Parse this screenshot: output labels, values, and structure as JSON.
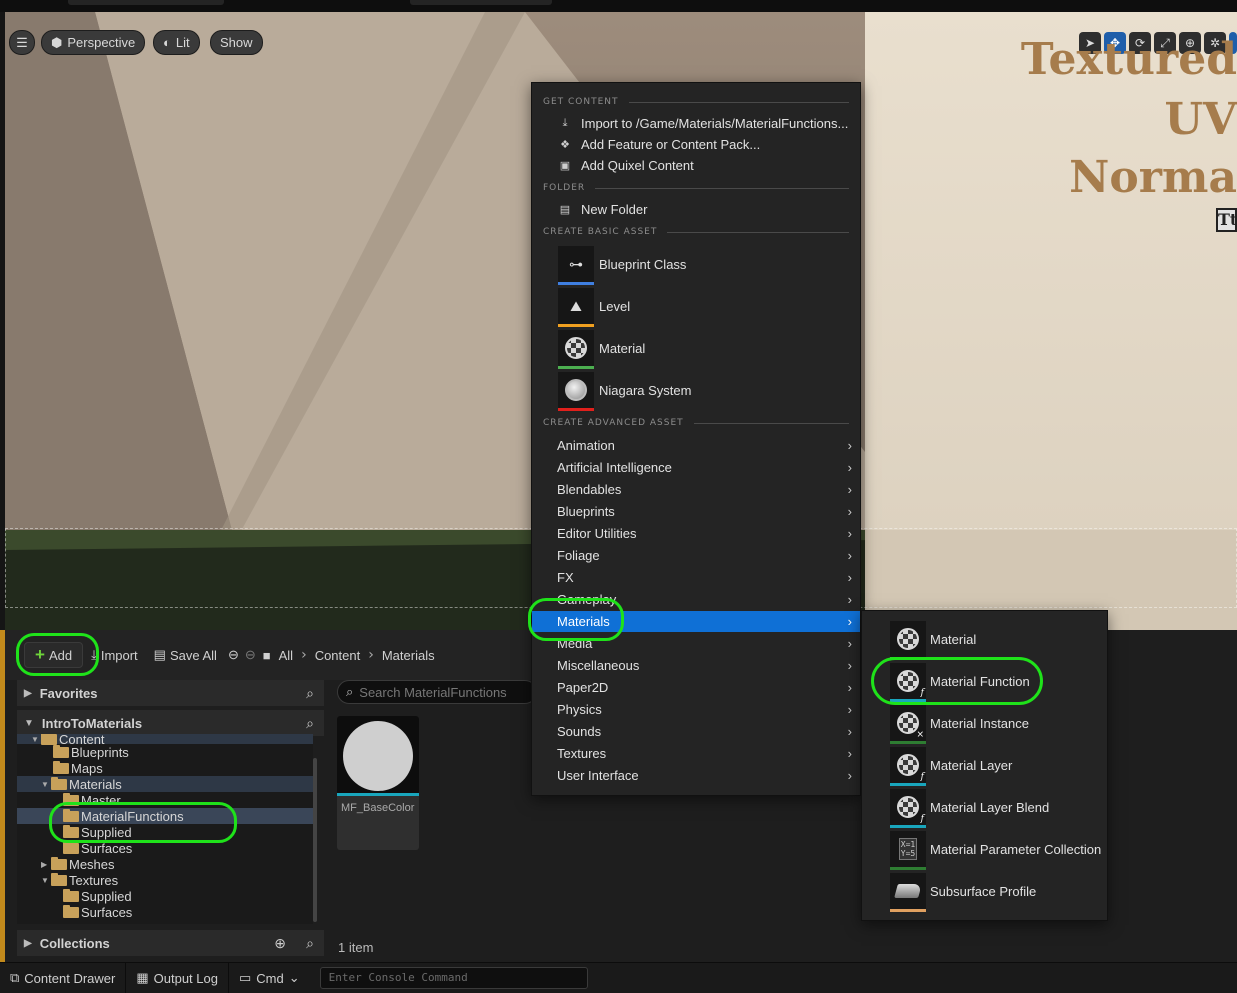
{
  "viewport": {
    "toolbar": {
      "menu_icon": "hamburger-icon",
      "perspective": "Perspective",
      "lit": "Lit",
      "show": "Show"
    },
    "overlay_text": {
      "line1": "Textured",
      "line2": "UV",
      "line3": "Norma",
      "box": "Tt"
    }
  },
  "content_browser": {
    "toolbar": {
      "add": "Add",
      "import": "Import",
      "save_all": "Save All",
      "all": "All",
      "crumb1": "Content",
      "crumb2": "Materials"
    },
    "favorites": "Favorites",
    "project": "IntroToMaterials",
    "collections": "Collections",
    "tree": [
      {
        "label": "Content",
        "indent": 1,
        "expanded": true
      },
      {
        "label": "Blueprints",
        "indent": 2
      },
      {
        "label": "Maps",
        "indent": 2
      },
      {
        "label": "Materials",
        "indent": 2,
        "expanded": true
      },
      {
        "label": "Master",
        "indent": 3
      },
      {
        "label": "MaterialFunctions",
        "indent": 3,
        "selected": true
      },
      {
        "label": "Supplied",
        "indent": 3
      },
      {
        "label": "Surfaces",
        "indent": 3
      },
      {
        "label": "Meshes",
        "indent": 2,
        "collapsed": true
      },
      {
        "label": "Textures",
        "indent": 2,
        "expanded": true
      },
      {
        "label": "Supplied",
        "indent": 3
      },
      {
        "label": "Surfaces",
        "indent": 3
      }
    ],
    "search_placeholder": "Search MaterialFunctions",
    "asset_name": "MF_BaseColor",
    "item_count": "1 item"
  },
  "statusbar": {
    "content_drawer": "Content Drawer",
    "output_log": "Output Log",
    "cmd": "Cmd",
    "console_placeholder": "Enter Console Command"
  },
  "menu": {
    "sections": {
      "get_content": "GET CONTENT",
      "folder": "FOLDER",
      "basic": "CREATE BASIC ASSET",
      "advanced": "CREATE ADVANCED ASSET"
    },
    "get_content": [
      {
        "label": "Import to /Game/Materials/MaterialFunctions...",
        "icon": "import-icon"
      },
      {
        "label": "Add Feature or Content Pack...",
        "icon": "feature-pack-icon"
      },
      {
        "label": "Add Quixel Content",
        "icon": "quixel-icon"
      }
    ],
    "new_folder": "New Folder",
    "basic": [
      {
        "label": "Blueprint Class",
        "color": "#3f7fe0"
      },
      {
        "label": "Level",
        "color": "#f0a020"
      },
      {
        "label": "Material",
        "color": "#4caf50"
      },
      {
        "label": "Niagara System",
        "color": "#e0201c"
      }
    ],
    "advanced": [
      "Animation",
      "Artificial Intelligence",
      "Blendables",
      "Blueprints",
      "Editor Utilities",
      "Foliage",
      "FX",
      "Gameplay",
      "Materials",
      "Media",
      "Miscellaneous",
      "Paper2D",
      "Physics",
      "Sounds",
      "Textures",
      "User Interface"
    ],
    "selected": "Materials"
  },
  "submenu": [
    {
      "label": "Material",
      "color": "#4caf50"
    },
    {
      "label": "Material Function",
      "color": "#19a6bd"
    },
    {
      "label": "Material Instance",
      "color": "#2e7d32"
    },
    {
      "label": "Material Layer",
      "color": "#19a6bd"
    },
    {
      "label": "Material Layer Blend",
      "color": "#19a6bd"
    },
    {
      "label": "Material Parameter Collection",
      "color": "#2e7d32"
    },
    {
      "label": "Subsurface Profile",
      "color": "#e0a060"
    }
  ],
  "colors": {
    "highlight": "#0f70d6",
    "annotation": "#1fe21a",
    "accent_orange": "#c28a1c"
  }
}
